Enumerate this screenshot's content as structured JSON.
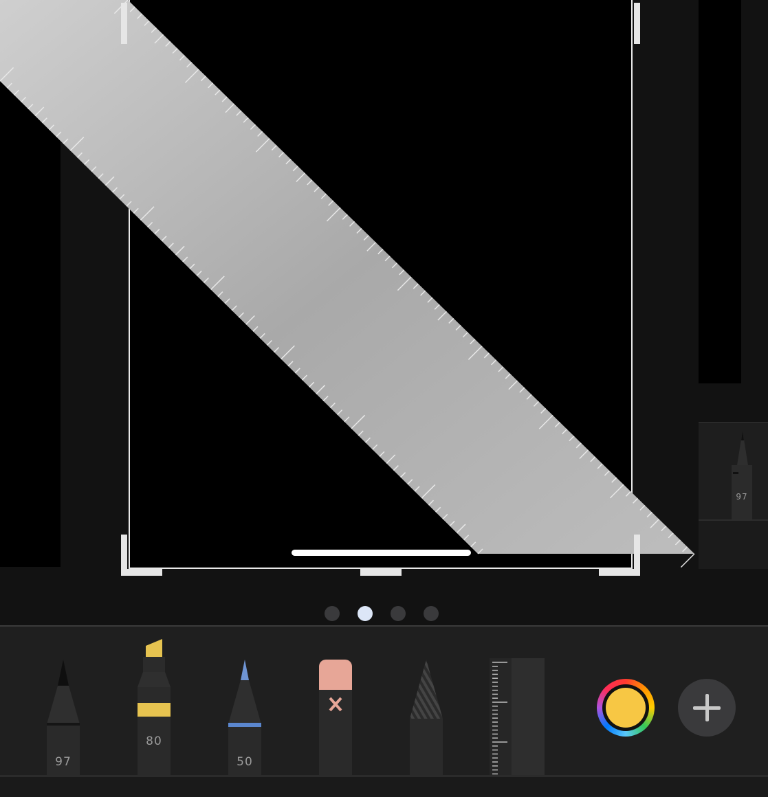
{
  "pages": {
    "indicator_count": 4,
    "active_index": 1
  },
  "toolbar": {
    "tools": [
      {
        "name": "pen",
        "label": "97",
        "accent": "#2b2b2b"
      },
      {
        "name": "marker",
        "label": "80",
        "accent": "#e6c350"
      },
      {
        "name": "pencil",
        "label": "50",
        "accent": "#6f95d4"
      },
      {
        "name": "eraser",
        "label": "",
        "accent": "#e7a697"
      },
      {
        "name": "lasso",
        "label": "",
        "accent": "#3a3a3a"
      },
      {
        "name": "ruler",
        "label": "",
        "accent": "#3c3c3c"
      }
    ],
    "selected_color": "#f7c744",
    "add_label": "+"
  },
  "side_panel": {
    "pen_label": "97"
  }
}
